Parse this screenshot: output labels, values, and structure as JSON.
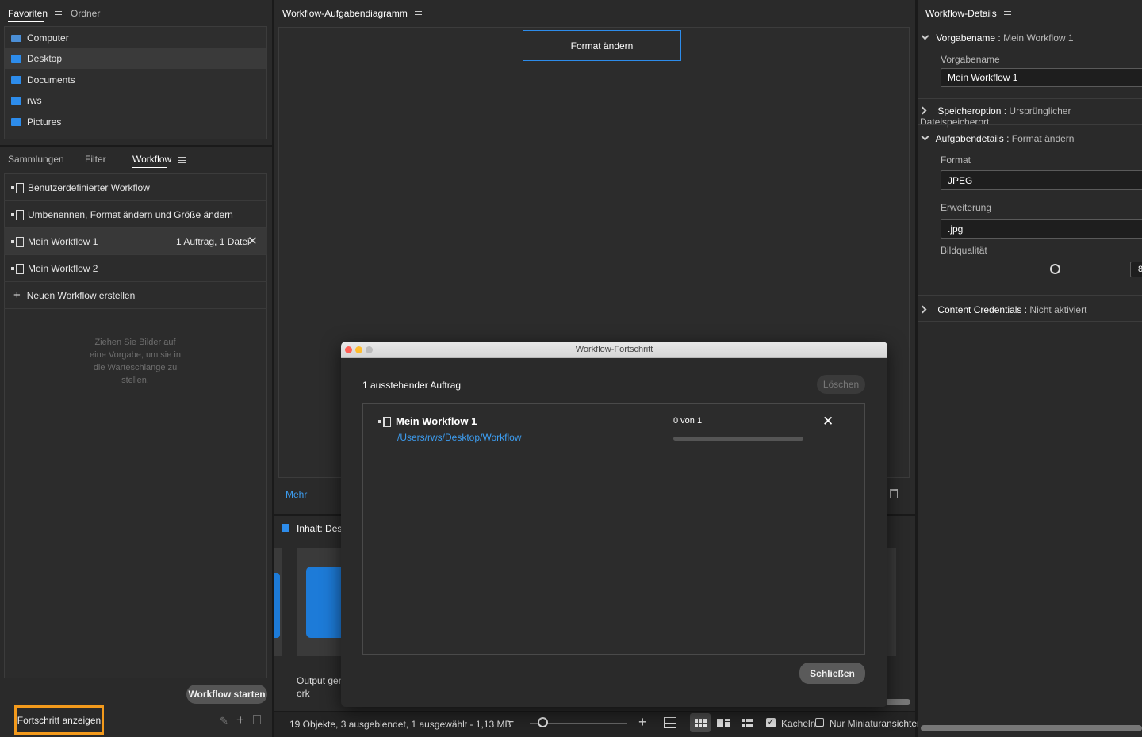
{
  "left": {
    "tabs": {
      "favoriten": "Favoriten",
      "ordner": "Ordner"
    },
    "favorites": [
      {
        "label": "Computer",
        "icon": "computer-icon"
      },
      {
        "label": "Desktop",
        "icon": "folder-icon"
      },
      {
        "label": "Documents",
        "icon": "folder-icon"
      },
      {
        "label": "rws",
        "icon": "folder-icon"
      },
      {
        "label": "Pictures",
        "icon": "folder-icon"
      }
    ],
    "lower_tabs": {
      "sammlungen": "Sammlungen",
      "filter": "Filter",
      "workflow": "Workflow"
    },
    "workflows": [
      {
        "label": "Benutzerdefinierter Workflow",
        "meta": ""
      },
      {
        "label": "Umbenennen, Format ändern und Größe ändern",
        "meta": ""
      },
      {
        "label": "Mein Workflow 1",
        "meta": "1 Auftrag, 1 Datei"
      },
      {
        "label": "Mein Workflow 2",
        "meta": ""
      }
    ],
    "new_workflow": "Neuen Workflow erstellen",
    "drop_hint": "Ziehen Sie Bilder auf eine Vorgabe, um sie in die Warteschlange zu stellen.",
    "start_button": "Workflow starten",
    "progress_button": "Fortschritt anzeigen"
  },
  "center": {
    "title": "Workflow-Aufgabendiagramm",
    "node": "Format ändern",
    "mehr": "Mehr",
    "content_title": "Inhalt: Deskt",
    "output_label": "Output gene",
    "output_label2": "ork",
    "status": "19 Objekte, 3 ausgeblendet, 1 ausgewählt - 1,13 MB",
    "kacheln": "Kacheln",
    "nur_miniatur": "Nur Miniaturansichten"
  },
  "right": {
    "title": "Workflow-Details",
    "vorgabename_key": "Vorgabename",
    "vorgabename_val": "Mein Workflow 1",
    "vorgabename_label": "Vorgabename",
    "vorgabename_input": "Mein Workflow 1",
    "speicher_key": "Speicheroption",
    "speicher_val": "Ursprünglicher Dateispeicherort",
    "aufgabe_key": "Aufgabendetails",
    "aufgabe_val": "Format ändern",
    "format_label": "Format",
    "format_val": "JPEG",
    "erweiterung_label": "Erweiterung",
    "erweiterung_val": ".jpg",
    "quality_label": "Bildqualität",
    "quality_val": "8",
    "cc_key": "Content Credentials",
    "cc_val": "Nicht aktiviert"
  },
  "dialog": {
    "title": "Workflow-Fortschritt",
    "pending": "1 ausstehender Auftrag",
    "delete": "Löschen",
    "job_name": "Mein Workflow 1",
    "job_path": "/Users/rws/Desktop/Workflow",
    "job_count": "0 von 1",
    "close": "Schließen"
  }
}
